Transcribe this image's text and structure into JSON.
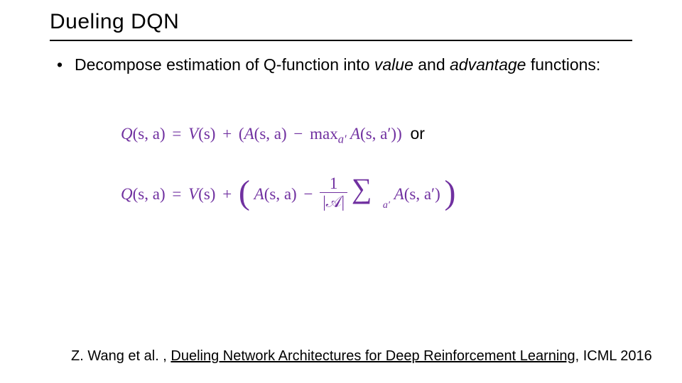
{
  "title": "Dueling DQN",
  "bullet": {
    "pre": "Decompose estimation of Q-function into ",
    "value": "value",
    "mid": " and ",
    "advantage": "advantage",
    "post": " functions:"
  },
  "eq1": {
    "q": "Q",
    "args_sa": "(s, a)",
    "eq": "=",
    "v": "V",
    "args_s": "(s)",
    "plus": "+",
    "lpar": "(",
    "a": "A",
    "minus": "−",
    "max": "max",
    "sub_a_prime": "a′",
    "args_sap": "(s, a′)",
    "rpar": ")",
    "or": " or"
  },
  "eq2": {
    "q": "Q",
    "args_sa": "(s, a)",
    "eq": "=",
    "v": "V",
    "args_s": "(s)",
    "plus": "+",
    "a": "A",
    "minus": "−",
    "one": "1",
    "absA": "|𝒜|",
    "sigma": "∑",
    "sub_a_prime": "a′",
    "args_sap": "(s, a′)"
  },
  "citation": {
    "pre": "Z. Wang et al. , ",
    "link": "Dueling Network Architectures for Deep Reinforcement Learning",
    "post": ", ICML 2016"
  }
}
